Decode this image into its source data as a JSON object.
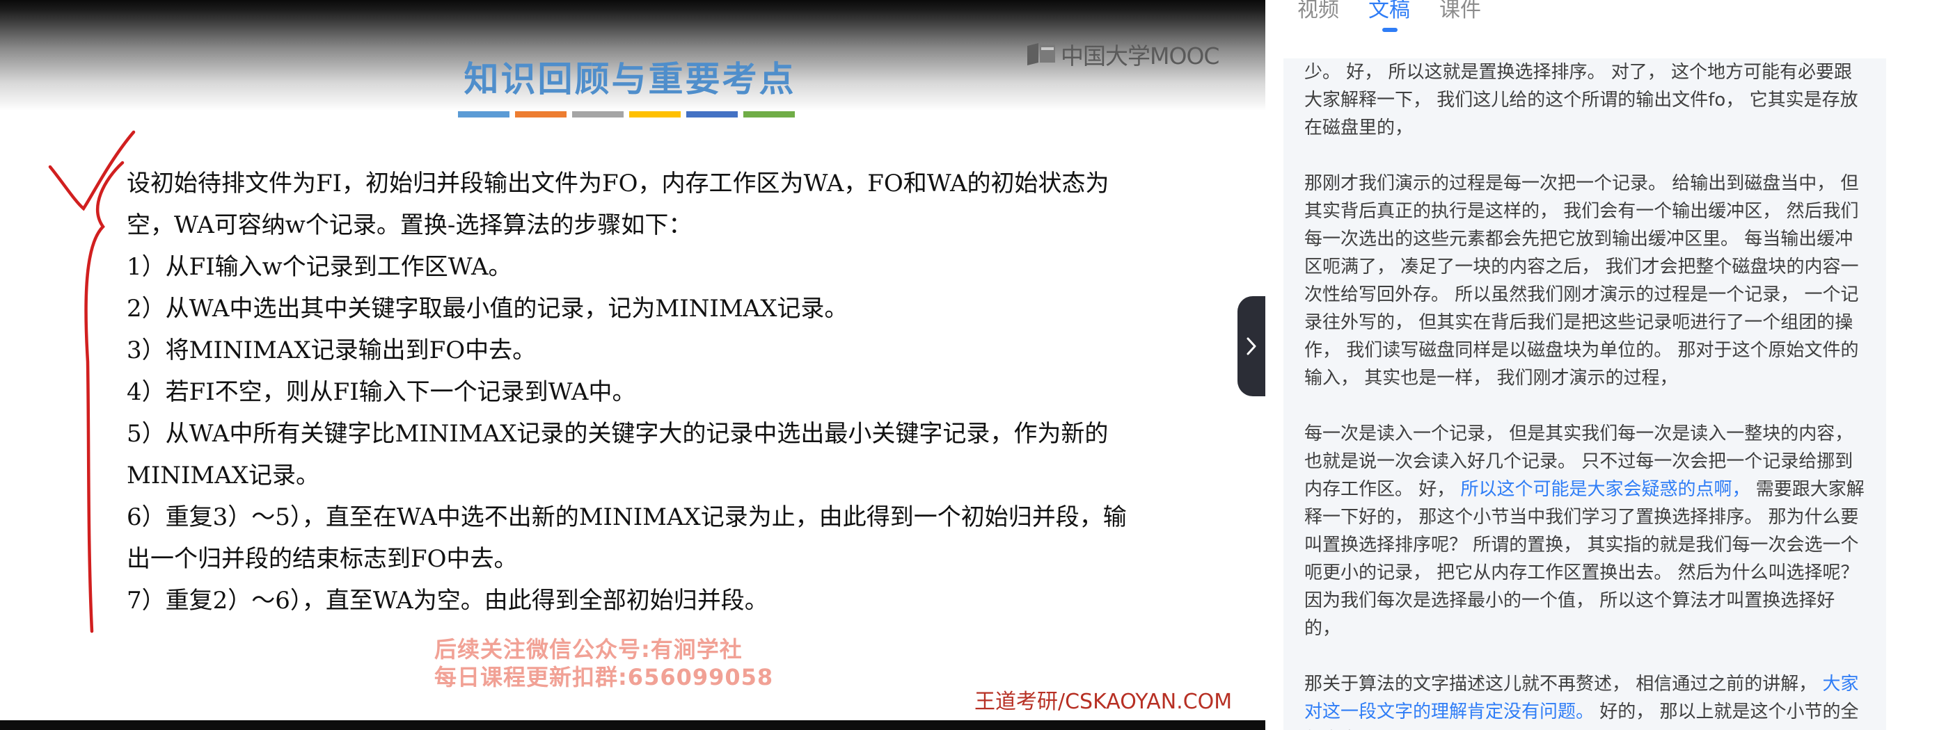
{
  "video": {
    "slide_title": "知识回顾与重要考点",
    "title_bar_colors": [
      "#5b9bd5",
      "#ed7d31",
      "#a5a5a5",
      "#ffc000",
      "#4472c4",
      "#70ad47"
    ],
    "logo_text": "中国大学MOOC",
    "lines": [
      "设初始待排文件为FI，初始归并段输出文件为FO，内存工作区为WA，FO和WA的初始状态为",
      "空，WA可容纳w个记录。置换-选择算法的步骤如下：",
      "1）从FI输入w个记录到工作区WA。",
      "2）从WA中选出其中关键字取最小值的记录，记为MINIMAX记录。",
      "3）将MINIMAX记录输出到FO中去。",
      "4）若FI不空，则从FI输入下一个记录到WA中。",
      "5）从WA中所有关键字比MINIMAX记录的关键字大的记录中选出最小关键字记录，作为新的",
      "MINIMAX记录。",
      "6）重复3）～5），直至在WA中选不出新的MINIMAX记录为止，由此得到一个初始归并段，输",
      "出一个归并段的结束标志到FO中去。",
      "7）重复2）～6），直至WA为空。由此得到全部初始归并段。"
    ],
    "watermark_line1": "后续关注微信公众号:有涧学社",
    "watermark_line2": "每日课程更新扣群:656099058",
    "footer_brand": "王道考研/CSKAOYAN.COM"
  },
  "panel": {
    "tabs": [
      {
        "label": "视频",
        "active": false
      },
      {
        "label": "文稿",
        "active": true
      },
      {
        "label": "课件",
        "active": false
      }
    ],
    "accent_color": "#2f7df6",
    "paragraphs": [
      {
        "before": "少。 好， 所以这就是置换选择排序。 对了， 这个地方可能有必要跟大家解释一下， 我们这儿给的这个所谓的输出文件fo， 它其实是存放在磁盘里的，",
        "highlight": "",
        "after": ""
      },
      {
        "before": "那刚才我们演示的过程是每一次把一个记录。 给输出到磁盘当中， 但其实背后真正的执行是这样的， 我们会有一个输出缓冲区， 然后我们每一次选出的这些元素都会先把它放到输出缓冲区里。 每当输出缓冲区呃满了， 凑足了一块的内容之后， 我们才会把整个磁盘块的内容一次性给写回外存。 所以虽然我们刚才演示的过程是一个记录， 一个记录往外写的， 但其实在背后我们是把这些记录呃进行了一个组团的操作， 我们读写磁盘同样是以磁盘块为单位的。 那对于这个原始文件的输入， 其实也是一样， 我们刚才演示的过程，",
        "highlight": "",
        "after": ""
      },
      {
        "before": "每一次是读入一个记录， 但是其实我们每一次是读入一整块的内容， 也就是说一次会读入好几个记录。 只不过每一次会把一个记录给挪到内存工作区。 好， ",
        "highlight": "所以这个可能是大家会疑惑的点啊，",
        "after": " 需要跟大家解释一下好的， 那这个小节当中我们学习了置换选择排序。 那为什么要叫置换选择排序呢？ 所谓的置换， 其实指的就是我们每一次会选一个呃更小的记录， 把它从内存工作区置换出去。 然后为什么叫选择呢？ 因为我们每次是选择最小的一个值， 所以这个算法才叫置换选择好的，"
      },
      {
        "before": "那关于算法的文字描述这儿就不再赘述， 相信通过之前的讲解， ",
        "highlight": "大家对这一段文字的理解肯定没有问题。",
        "after": " 好的， 那以上就是这个小节的全部内容。"
      }
    ]
  }
}
